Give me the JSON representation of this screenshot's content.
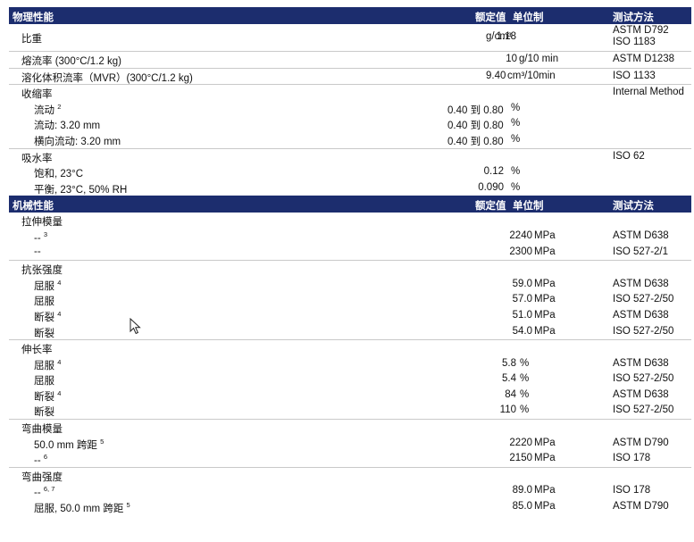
{
  "sections": [
    {
      "header": {
        "title": "物理性能",
        "value": "额定值",
        "unit": "单位制",
        "method": "测试方法"
      },
      "groups": [
        {
          "rows": [
            {
              "name": "比重",
              "value": "1.18",
              "unit": "g/cm³",
              "method_line1": "ASTM D792",
              "method_line2": "ISO 1183"
            }
          ]
        },
        {
          "rows": [
            {
              "name": "熔流率 (300°C/1.2 kg)",
              "value": "10",
              "unit": "g/10 min",
              "method": "ASTM D1238"
            }
          ]
        },
        {
          "rows": [
            {
              "name": "溶化体积流率（MVR）(300°C/1.2 kg)",
              "value": "9.40",
              "unit": "cm³/10min",
              "method": "ISO 1133"
            }
          ]
        },
        {
          "rows": [
            {
              "name": "收缩率",
              "method": "Internal Method"
            },
            {
              "name": "流动",
              "sup": "2",
              "value": "0.40 到 0.80",
              "unit": "%"
            },
            {
              "name": "流动: 3.20 mm",
              "value": "0.40 到 0.80",
              "unit": "%"
            },
            {
              "name": "横向流动: 3.20 mm",
              "value": "0.40 到 0.80",
              "unit": "%"
            }
          ]
        },
        {
          "rows": [
            {
              "name": "吸水率",
              "method": "ISO 62"
            },
            {
              "name": "饱和, 23°C",
              "value": "0.12",
              "unit": "%"
            },
            {
              "name": "平衡, 23°C, 50% RH",
              "value": "0.090",
              "unit": "%"
            }
          ]
        }
      ]
    },
    {
      "header": {
        "title": "机械性能",
        "value": "额定值",
        "unit": "单位制",
        "method": "测试方法"
      },
      "groups": [
        {
          "rows": [
            {
              "name": "拉伸模量"
            },
            {
              "name": "--",
              "sup": "3",
              "value": "2240",
              "unit": "MPa",
              "method": "ASTM D638"
            },
            {
              "name": "--",
              "value": "2300",
              "unit": "MPa",
              "method": "ISO 527-2/1"
            }
          ]
        },
        {
          "rows": [
            {
              "name": "抗张强度"
            },
            {
              "name": "屈服",
              "sup": "4",
              "value": "59.0",
              "unit": "MPa",
              "method": "ASTM D638"
            },
            {
              "name": "屈服",
              "value": "57.0",
              "unit": "MPa",
              "method": "ISO 527-2/50"
            },
            {
              "name": "断裂",
              "sup": "4",
              "value": "51.0",
              "unit": "MPa",
              "method": "ASTM D638"
            },
            {
              "name": "断裂",
              "value": "54.0",
              "unit": "MPa",
              "method": "ISO 527-2/50"
            }
          ]
        },
        {
          "rows": [
            {
              "name": "伸长率"
            },
            {
              "name": "屈服",
              "sup": "4",
              "value": "5.8",
              "unit": "%",
              "method": "ASTM D638"
            },
            {
              "name": "屈服",
              "value": "5.4",
              "unit": "%",
              "method": "ISO 527-2/50"
            },
            {
              "name": "断裂",
              "sup": "4",
              "value": "84",
              "unit": "%",
              "method": "ASTM D638"
            },
            {
              "name": "断裂",
              "value": "110",
              "unit": "%",
              "method": "ISO 527-2/50"
            }
          ]
        },
        {
          "rows": [
            {
              "name": "弯曲模量"
            },
            {
              "name": "50.0 mm 跨距",
              "sup": "5",
              "value": "2220",
              "unit": "MPa",
              "method": "ASTM D790"
            },
            {
              "name": "--",
              "sup": "6",
              "value": "2150",
              "unit": "MPa",
              "method": "ISO 178"
            }
          ]
        },
        {
          "rows": [
            {
              "name": "弯曲强度"
            },
            {
              "name": "--",
              "sup": "6, 7",
              "value": "89.0",
              "unit": "MPa",
              "method": "ISO 178"
            },
            {
              "name": "屈服, 50.0 mm 跨距",
              "sup": "5",
              "value": "85.0",
              "unit": "MPa",
              "method": "ASTM D790"
            }
          ]
        }
      ]
    }
  ]
}
